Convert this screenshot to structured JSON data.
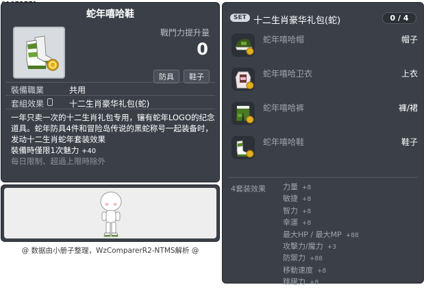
{
  "item_id": "01072771",
  "item": {
    "name": "蛇年嘻哈鞋",
    "stat_label": "戰鬥力提升量",
    "stat_value": "0",
    "chips": [
      "防具",
      "鞋子"
    ],
    "job_label": "裝備職業",
    "job_value": "共用",
    "set_label": "套組效果",
    "set_value": "十二生肖豪华礼包(蛇)",
    "description": "一年只卖一次的十二生肖礼包专用，镶有蛇年LOGO的纪念道具。蛇年防具4件和冒险岛传说的黑蛇称号一起装备时，发动十二生肖蛇年套装效果",
    "charm_label": "裝備時僅限1次魅力",
    "charm_value": "+40",
    "limit_text": "每日限制、超過上限時除外"
  },
  "credit": "@ 数据由小册子整理，WzComparerR2-NTMS解析 @",
  "set": {
    "badge": "SET",
    "title": "十二生肖豪华礼包(蛇)",
    "count": "0 / 4",
    "items": [
      {
        "name": "蛇年嘻哈帽",
        "slot": "帽子",
        "icon": "cap-icon"
      },
      {
        "name": "蛇年嘻哈卫衣",
        "slot": "上衣",
        "icon": "hoodie-icon"
      },
      {
        "name": "蛇年嘻哈裤",
        "slot": "褲/裙",
        "icon": "pants-icon"
      },
      {
        "name": "蛇年嘻哈鞋",
        "slot": "鞋子",
        "icon": "shoes-icon"
      }
    ],
    "effect_label": "4套装效果",
    "effects": [
      {
        "name": "力量",
        "value": "+8"
      },
      {
        "name": "敏捷",
        "value": "+8"
      },
      {
        "name": "智力",
        "value": "+8"
      },
      {
        "name": "幸運",
        "value": "+8"
      },
      {
        "name": "最大HP / 最大MP",
        "value": "+88"
      },
      {
        "name": "攻擊力/魔力",
        "value": "+3"
      },
      {
        "name": "防禦力",
        "value": "+88"
      },
      {
        "name": "移動速度",
        "value": "+8"
      },
      {
        "name": "跳躍力",
        "value": "+8"
      }
    ]
  },
  "colors": {
    "panel_bg": "#3b4048",
    "accent_green": "#5a8a2a",
    "coin_gold": "#e0b020"
  }
}
